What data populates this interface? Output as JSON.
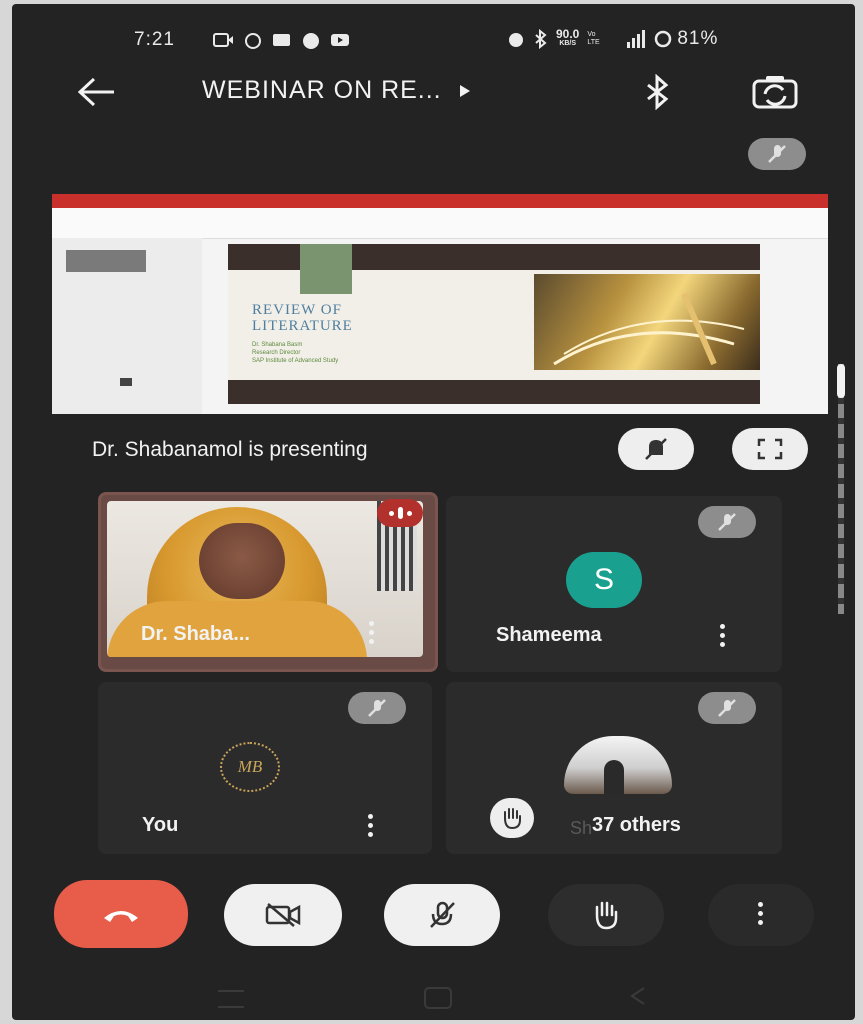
{
  "status_bar": {
    "time": "7:21",
    "net_speed_value": "90.0",
    "net_speed_unit": "KB/S",
    "signal_label": "Vo LTE",
    "battery": "81%"
  },
  "header": {
    "title": "WEBINAR ON RE...",
    "back_icon": "arrow-left-icon",
    "audio_icon": "bluetooth-icon",
    "switch_camera_icon": "camera-switch-icon"
  },
  "presentation": {
    "slide_title_line1": "REVIEW OF",
    "slide_title_line2": "LITERATURE",
    "slide_sub1": "Dr. Shabana Basm",
    "slide_sub2": "Research Director",
    "slide_sub3": "SAP Institute of Advanced Study",
    "presenting_text": "Dr. Shabanamol is presenting"
  },
  "participants": {
    "tile1_name": "Dr. Shaba...",
    "tile2_name": "Shameema",
    "tile2_initial": "S",
    "tile3_name": "You",
    "tile3_logo": "MB",
    "tile4_name": "37 others",
    "tile4_partial": "Sh"
  },
  "colors": {
    "end_call": "#e85c4a",
    "avatar_teal": "#19a08f",
    "accent_red": "#c9302c"
  }
}
